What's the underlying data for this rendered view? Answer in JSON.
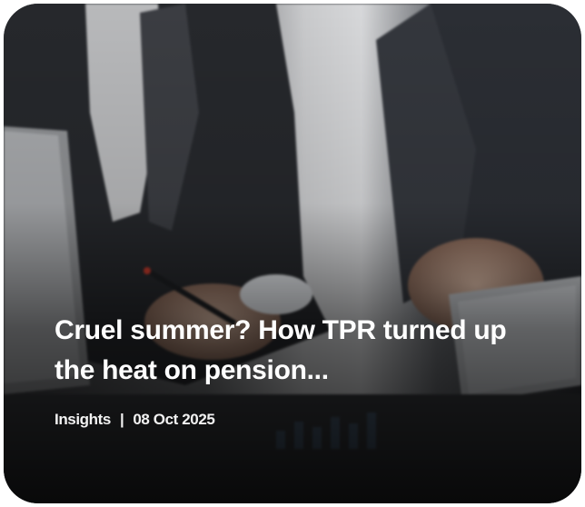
{
  "card": {
    "title": "Cruel summer? How TPR turned up the heat on pension...",
    "category": "Insights",
    "separator": "|",
    "date": "08 Oct 2025",
    "image_alt": "business-meeting-photo"
  }
}
